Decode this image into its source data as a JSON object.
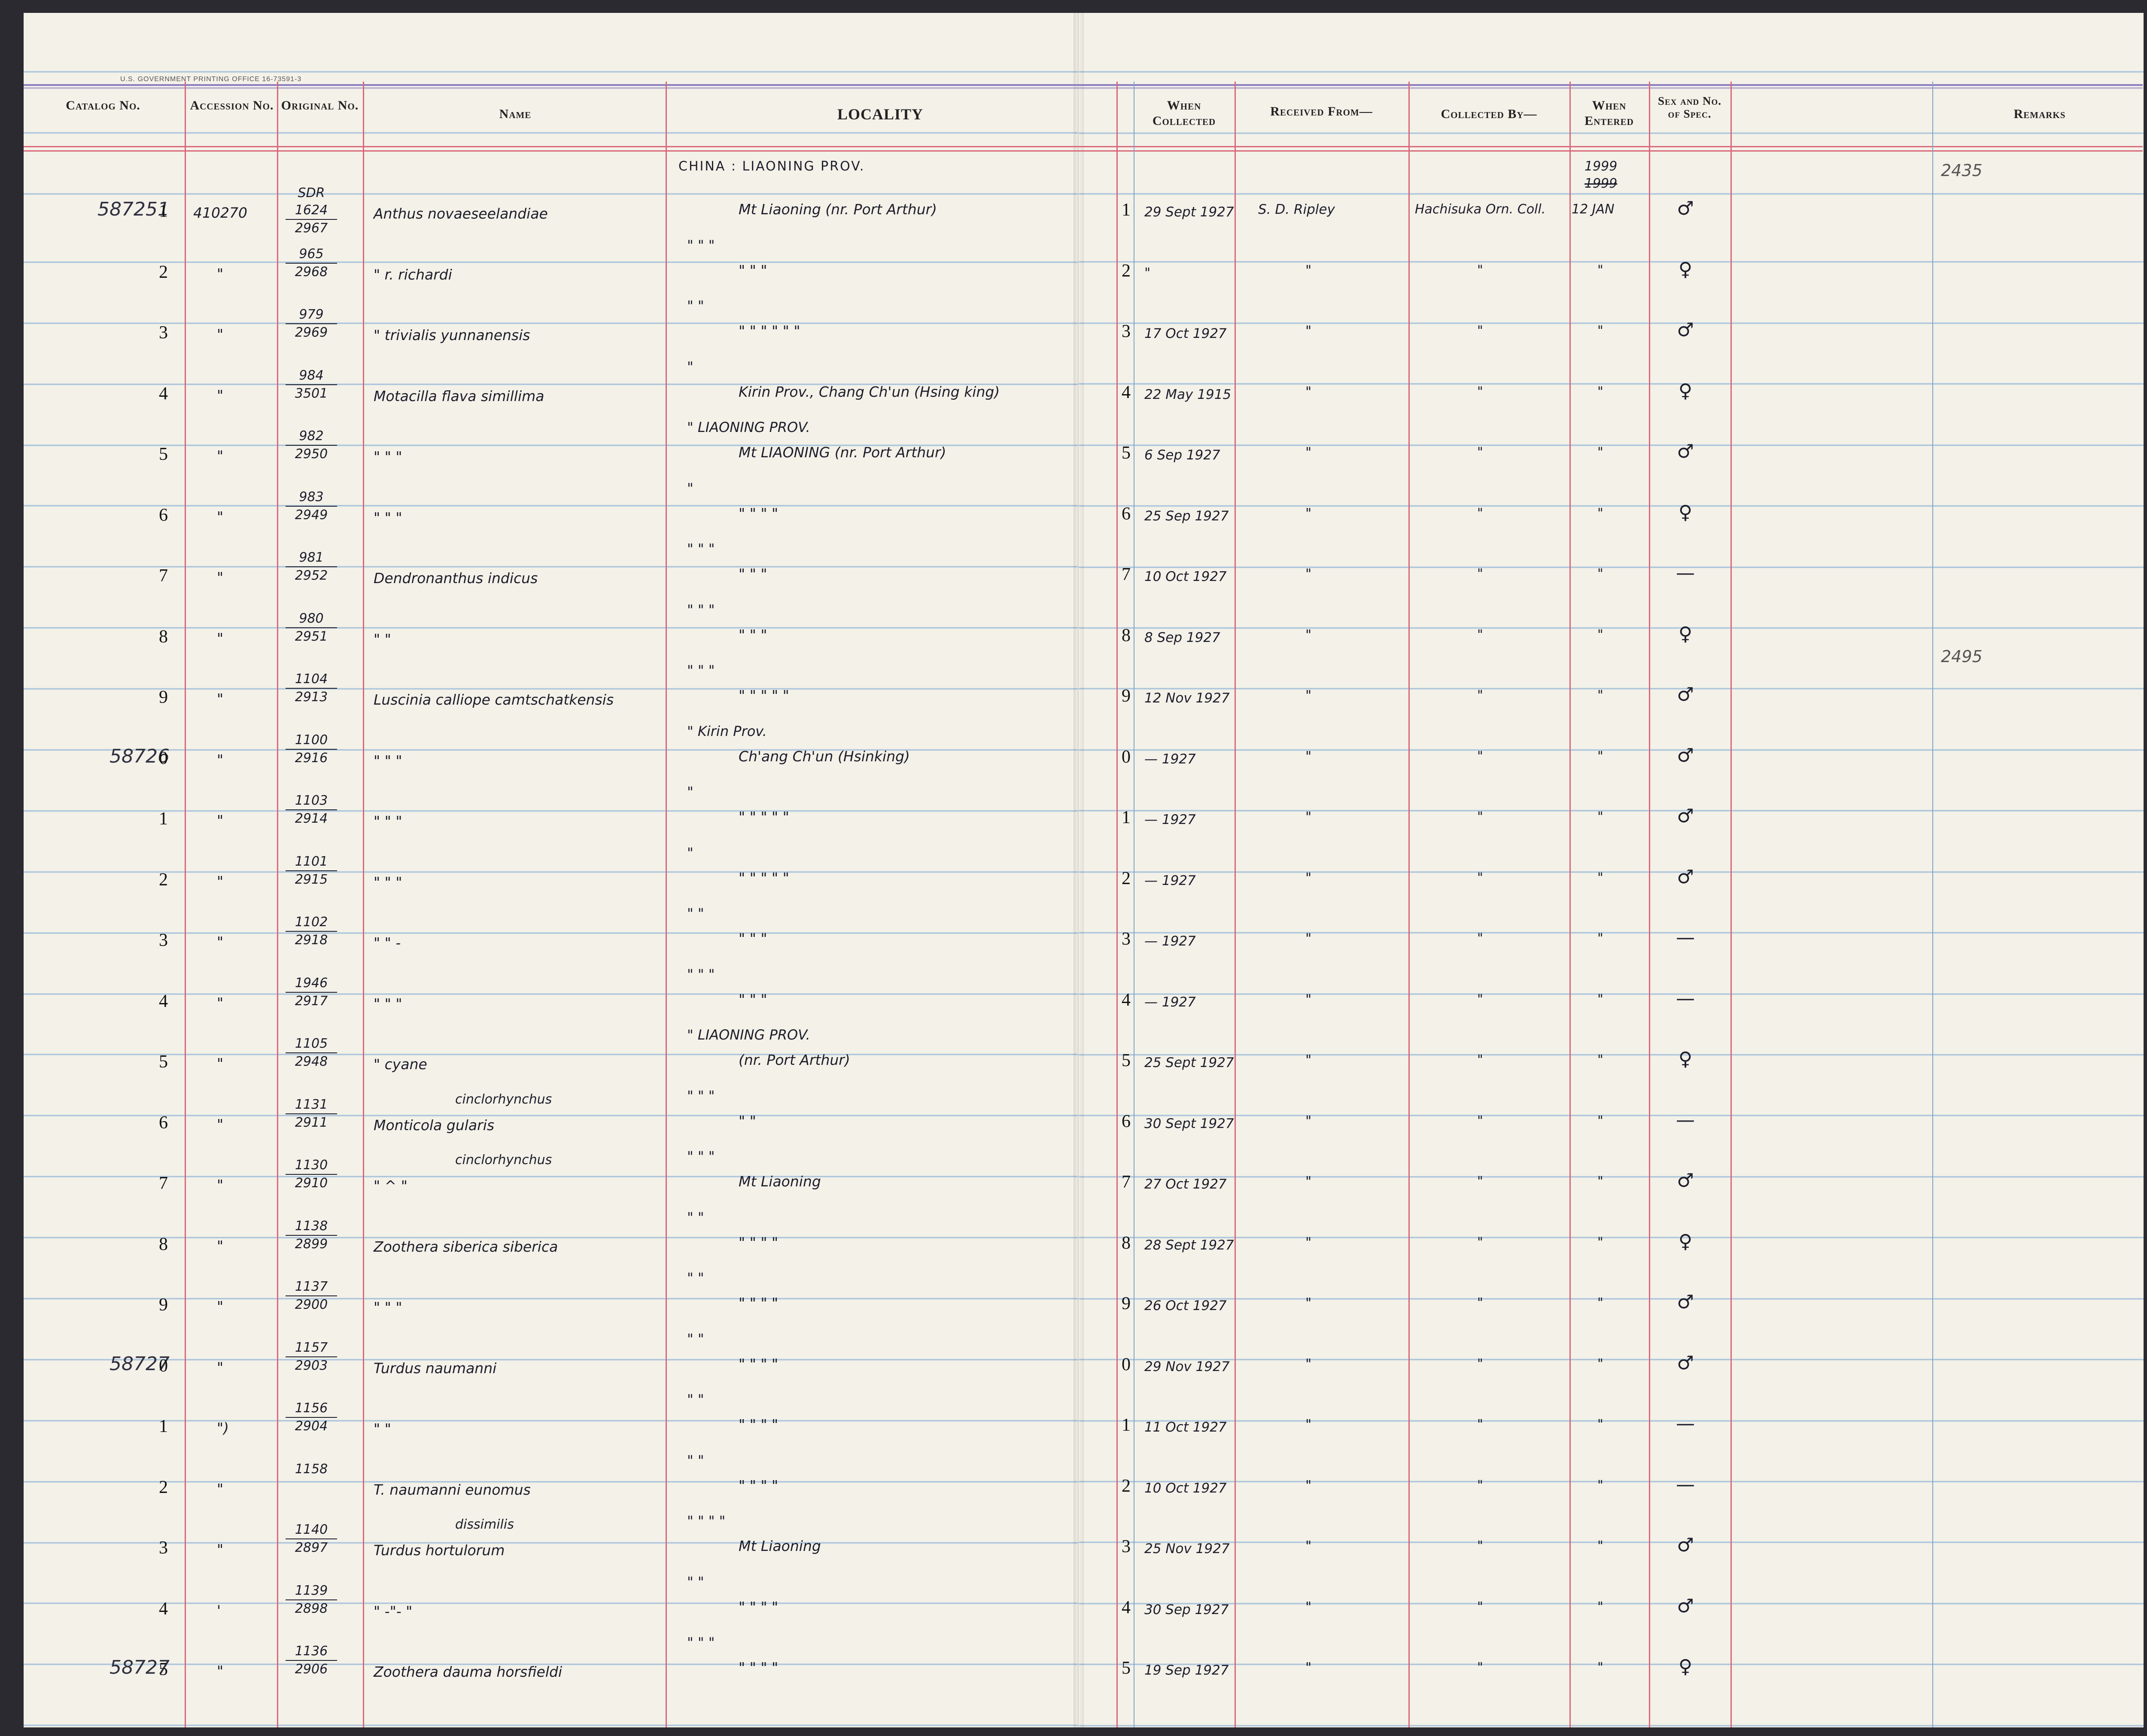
{
  "header": {
    "printer": "U.S. GOVERNMENT PRINTING OFFICE   16-73591-3",
    "catalog": "Catalog No.",
    "accession": "Accession No.",
    "original": "Original No.",
    "name": "Name",
    "locality": "LOCALITY",
    "when_collected": "When Collected",
    "received_from": "Received From—",
    "collected_by": "Collected By—",
    "when_entered": "When Entered",
    "sex": "Sex and No. of Spec.",
    "remarks": "Remarks"
  },
  "page_top_note": "CHINA : LIAONING PROV.",
  "entered_note_top": "1999",
  "entered_note_struck": "1999",
  "rows": [
    {
      "cat_prefix": "587251",
      "cat_digit": "1",
      "accession": "410270",
      "orig_top": "SDR 1624",
      "orig_bot": "2967",
      "name": "Anthus novaeseelandiae",
      "loc_above": "",
      "loc": "Mt Liaoning (nr. Port Arthur)",
      "row_digit": "1",
      "when": "29 Sept 1927",
      "recv": "S. D. Ripley",
      "coll": "Hachisuka Orn. Coll.",
      "entered": "12 JAN",
      "sex": "♂",
      "remark": "2435"
    },
    {
      "cat_prefix": "",
      "cat_digit": "2",
      "accession": "\"",
      "orig_top": "965",
      "orig_bot": "2968",
      "name": "\"  r. richardi",
      "loc_above": "\"   \"   \"",
      "loc": "\"   \"   \"",
      "row_digit": "2",
      "when": "\"",
      "recv": "\"",
      "coll": "\"",
      "entered": "\"",
      "sex": "♀",
      "remark": ""
    },
    {
      "cat_prefix": "",
      "cat_digit": "3",
      "accession": "\"",
      "orig_top": "979",
      "orig_bot": "2969",
      "name": "\"  trivialis yunnanensis",
      "loc_above": "\"   \"",
      "loc": "\"   \"   \"   \"   \"   \"",
      "row_digit": "3",
      "when": "17 Oct 1927",
      "recv": "\"",
      "coll": "\"",
      "entered": "\"",
      "sex": "♂",
      "remark": ""
    },
    {
      "cat_prefix": "",
      "cat_digit": "4",
      "accession": "\"",
      "orig_top": "984",
      "orig_bot": "3501",
      "name": "Motacilla flava simillima",
      "loc_above": "\"",
      "loc": "Kirin Prov., Chang Ch'un (Hsing king)",
      "row_digit": "4",
      "when": "22 May 1915",
      "recv": "\"",
      "coll": "\"",
      "entered": "\"",
      "sex": "♀",
      "remark": ""
    },
    {
      "cat_prefix": "",
      "cat_digit": "5",
      "accession": "\"",
      "orig_top": "982",
      "orig_bot": "2950",
      "name": "\"   \"   \"",
      "loc_above": "\"  LIAONING PROV.",
      "loc": "Mt LIAONING (nr. Port Arthur)",
      "row_digit": "5",
      "when": "6 Sep 1927",
      "recv": "\"",
      "coll": "\"",
      "entered": "\"",
      "sex": "♂",
      "remark": ""
    },
    {
      "cat_prefix": "",
      "cat_digit": "6",
      "accession": "\"",
      "orig_top": "983",
      "orig_bot": "2949",
      "name": "\"   \"   \"",
      "loc_above": "\"",
      "loc": "\"   \"   \"   \"",
      "row_digit": "6",
      "when": "25 Sep 1927",
      "recv": "\"",
      "coll": "\"",
      "entered": "\"",
      "sex": "♀",
      "remark": ""
    },
    {
      "cat_prefix": "",
      "cat_digit": "7",
      "accession": "\"",
      "orig_top": "981",
      "orig_bot": "2952",
      "name": "Dendronanthus indicus",
      "loc_above": "\"   \"   \"",
      "loc": "\"   \"   \"",
      "row_digit": "7",
      "when": "10 Oct 1927",
      "recv": "\"",
      "coll": "\"",
      "entered": "\"",
      "sex": "—",
      "remark": ""
    },
    {
      "cat_prefix": "",
      "cat_digit": "8",
      "accession": "\"",
      "orig_top": "980",
      "orig_bot": "2951",
      "name": "\"   \"",
      "loc_above": "\"   \"   \"",
      "loc": "\"   \"   \"",
      "row_digit": "8",
      "when": "8 Sep 1927",
      "recv": "\"",
      "coll": "\"",
      "entered": "\"",
      "sex": "♀",
      "remark": ""
    },
    {
      "cat_prefix": "",
      "cat_digit": "9",
      "accession": "\"",
      "orig_top": "1104",
      "orig_bot": "2913",
      "name": "Luscinia calliope camtschatkensis",
      "loc_above": "\"   \"   \"",
      "loc": "\"   \"   \"   \"   \"",
      "row_digit": "9",
      "when": "12 Nov 1927",
      "recv": "\"",
      "coll": "\"",
      "entered": "\"",
      "sex": "♂",
      "remark": "2495"
    },
    {
      "cat_prefix": "58726",
      "cat_digit": "0",
      "accession": "\"",
      "orig_top": "1100",
      "orig_bot": "2916",
      "name": "\"   \"   \"",
      "loc_above": "\"  Kirin Prov.",
      "loc": "Ch'ang Ch'un (Hsinking)",
      "row_digit": "0",
      "when": "— 1927",
      "recv": "\"",
      "coll": "\"",
      "entered": "\"",
      "sex": "♂",
      "remark": ""
    },
    {
      "cat_prefix": "",
      "cat_digit": "1",
      "accession": "\"",
      "orig_top": "1103",
      "orig_bot": "2914",
      "name": "\"   \"   \"",
      "loc_above": "\"",
      "loc": "\"   \"   \"   \"   \"",
      "row_digit": "1",
      "when": "— 1927",
      "recv": "\"",
      "coll": "\"",
      "entered": "\"",
      "sex": "♂",
      "remark": ""
    },
    {
      "cat_prefix": "",
      "cat_digit": "2",
      "accession": "\"",
      "orig_top": "1101",
      "orig_bot": "2915",
      "name": "\"   \"   \"",
      "loc_above": "\"",
      "loc": "\"   \"   \"   \"   \"",
      "row_digit": "2",
      "when": "— 1927",
      "recv": "\"",
      "coll": "\"",
      "entered": "\"",
      "sex": "♂",
      "remark": ""
    },
    {
      "cat_prefix": "",
      "cat_digit": "3",
      "accession": "\"",
      "orig_top": "1102",
      "orig_bot": "2918",
      "name": "\"   \"   -",
      "loc_above": "\"   \"",
      "loc": "\"   \"   \"",
      "row_digit": "3",
      "when": "— 1927",
      "recv": "\"",
      "coll": "\"",
      "entered": "\"",
      "sex": "—",
      "remark": ""
    },
    {
      "cat_prefix": "",
      "cat_digit": "4",
      "accession": "\"",
      "orig_top": "1946",
      "orig_bot": "2917",
      "name": "\"   \"   \"",
      "loc_above": "\"   \"   \"",
      "loc": "\"   \"   \"",
      "row_digit": "4",
      "when": "— 1927",
      "recv": "\"",
      "coll": "\"",
      "entered": "\"",
      "sex": "—",
      "remark": ""
    },
    {
      "cat_prefix": "",
      "cat_digit": "5",
      "accession": "\"",
      "orig_top": "1105",
      "orig_bot": "2948",
      "name": "\"   cyane",
      "loc_above": "\"  LIAONING PROV.",
      "loc": "(nr. Port Arthur)",
      "row_digit": "5",
      "when": "25 Sept 1927",
      "recv": "\"",
      "coll": "\"",
      "entered": "\"",
      "sex": "♀",
      "remark": ""
    },
    {
      "cat_prefix": "",
      "cat_digit": "6",
      "accession": "\"",
      "orig_top": "1131",
      "orig_bot": "2911",
      "name": "Monticola gularis",
      "name_above": "cinclorhynchus",
      "loc_above": "\"   \"   \"",
      "loc": "\"   \"",
      "row_digit": "6",
      "when": "30 Sept 1927",
      "recv": "\"",
      "coll": "\"",
      "entered": "\"",
      "sex": "—",
      "remark": ""
    },
    {
      "cat_prefix": "",
      "cat_digit": "7",
      "accession": "\"",
      "orig_top": "1130",
      "orig_bot": "2910",
      "name": "\"  ^  \"",
      "name_above": "cinclorhynchus",
      "loc_above": "\"   \"   \"",
      "loc": "Mt Liaoning",
      "row_digit": "7",
      "when": "27 Oct 1927",
      "recv": "\"",
      "coll": "\"",
      "entered": "\"",
      "sex": "♂",
      "remark": ""
    },
    {
      "cat_prefix": "",
      "cat_digit": "8",
      "accession": "\"",
      "orig_top": "1138",
      "orig_bot": "2899",
      "name": "Zoothera siberica siberica",
      "loc_above": "\"   \"",
      "loc": "\"   \"   \"   \"",
      "row_digit": "8",
      "when": "28 Sept 1927",
      "recv": "\"",
      "coll": "\"",
      "entered": "\"",
      "sex": "♀",
      "remark": ""
    },
    {
      "cat_prefix": "",
      "cat_digit": "9",
      "accession": "\"",
      "orig_top": "1137",
      "orig_bot": "2900",
      "name": "\"   \"   \"",
      "loc_above": "\"   \"",
      "loc": "\"   \"   \"   \"",
      "row_digit": "9",
      "when": "26 Oct 1927",
      "recv": "\"",
      "coll": "\"",
      "entered": "\"",
      "sex": "♂",
      "remark": ""
    },
    {
      "cat_prefix": "58727",
      "cat_digit": "0",
      "accession": "\"",
      "orig_top": "1157",
      "orig_bot": "2903",
      "name": "Turdus naumanni",
      "loc_above": "\"   \"",
      "loc": "\"   \"   \"   \"",
      "row_digit": "0",
      "when": "29 Nov 1927",
      "recv": "\"",
      "coll": "\"",
      "entered": "\"",
      "sex": "♂",
      "remark": ""
    },
    {
      "cat_prefix": "",
      "cat_digit": "1",
      "accession": "\")",
      "orig_top": "1156",
      "orig_bot": "2904",
      "name": "\"   \"",
      "loc_above": "\"   \"",
      "loc": "\"   \"   \"   \"",
      "row_digit": "1",
      "when": "11 Oct 1927",
      "recv": "\"",
      "coll": "\"",
      "entered": "\"",
      "sex": "—",
      "remark": ""
    },
    {
      "cat_prefix": "",
      "cat_digit": "2",
      "accession": "\"",
      "orig_top": "1158",
      "orig_bot": "",
      "name": "T. naumanni eunomus",
      "loc_above": "\"   \"",
      "loc": "\"   \"   \"   \"",
      "row_digit": "2",
      "when": "10 Oct 1927",
      "recv": "\"",
      "coll": "\"",
      "entered": "\"",
      "sex": "—",
      "remark": ""
    },
    {
      "cat_prefix": "",
      "cat_digit": "3",
      "accession": "\"",
      "orig_top": "1140",
      "orig_bot": "2897",
      "name": "Turdus hortulorum",
      "name_above": "dissimilis",
      "loc_above": "\"   \"   \"   \"",
      "loc": "Mt Liaoning",
      "row_digit": "3",
      "when": "25 Nov 1927",
      "recv": "\"",
      "coll": "\"",
      "entered": "\"",
      "sex": "♂",
      "remark": ""
    },
    {
      "cat_prefix": "",
      "cat_digit": "4",
      "accession": "'",
      "orig_top": "1139",
      "orig_bot": "2898",
      "name": "\"  -\"-  \"",
      "loc_above": "\"   \"",
      "loc": "\"   \"   \"   \"",
      "row_digit": "4",
      "when": "30 Sep 1927",
      "recv": "\"",
      "coll": "\"",
      "entered": "\"",
      "sex": "♂",
      "remark": ""
    },
    {
      "cat_prefix": "58727",
      "cat_digit": "5",
      "accession": "\"",
      "orig_top": "1136",
      "orig_bot": "2906",
      "name": "Zoothera dauma horsfieldi",
      "loc_above": "\"   \"   \"",
      "loc": "\"   \"   \"   \"",
      "row_digit": "5",
      "when": "19 Sep 1927",
      "recv": "\"",
      "coll": "\"",
      "entered": "\"",
      "sex": "♀",
      "remark": ""
    }
  ]
}
